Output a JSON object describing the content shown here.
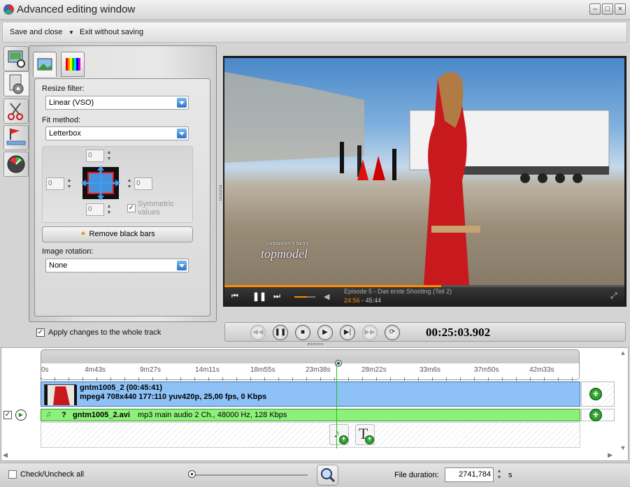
{
  "window": {
    "title": "Advanced editing window"
  },
  "menu": {
    "save_close": "Save and close",
    "exit": "Exit without saving"
  },
  "settings": {
    "resize_label": "Resize filter:",
    "resize_value": "Linear (VSO)",
    "fit_label": "Fit method:",
    "fit_value": "Letterbox",
    "crop_top": "0",
    "crop_left": "0",
    "crop_right": "0",
    "crop_bottom": "0",
    "symmetric_label_1": "Symmetric",
    "symmetric_label_2": "values",
    "remove_black_bars": "Remove black bars",
    "rotation_label": "Image rotation:",
    "rotation_value": "None",
    "apply_whole_track": "Apply changes to the whole track"
  },
  "video": {
    "logo_line1": "GERMANY'S NEXT",
    "logo_line2": "topmodel",
    "episode_title": "Episode 5 - Das erste Shooting (Teil 2)",
    "current_time": "24:56",
    "time_separator": "-",
    "total_time": "45:44"
  },
  "transport": {
    "timecode": "00:25:03.902"
  },
  "timeline": {
    "ticks": [
      "0s",
      "4m43s",
      "9m27s",
      "14m11s",
      "18m55s",
      "23m38s",
      "28m22s",
      "33m6s",
      "37m50s",
      "42m33s"
    ],
    "video_clip": {
      "name": "gntm1005_2 (00:45:41)",
      "info": "mpeg4 708x440 177:110 yuv420p, 25,00 fps, 0 Kbps"
    },
    "audio_clip": {
      "flag": "?",
      "name": "gntm1005_2.avi",
      "info": "mp3 main audio 2 Ch., 48000 Hz, 128 Kbps"
    },
    "add_label": "+",
    "text_icon_label": "T"
  },
  "status": {
    "check_all": "Check/Uncheck all",
    "file_duration_label": "File duration:",
    "file_duration_value": "2741,784",
    "file_duration_unit": "s"
  },
  "colors": {
    "video_track": "#8ec1f6",
    "audio_track": "#8df07a",
    "accent": "#2b74c9",
    "player_progress": "#ff8a00"
  }
}
